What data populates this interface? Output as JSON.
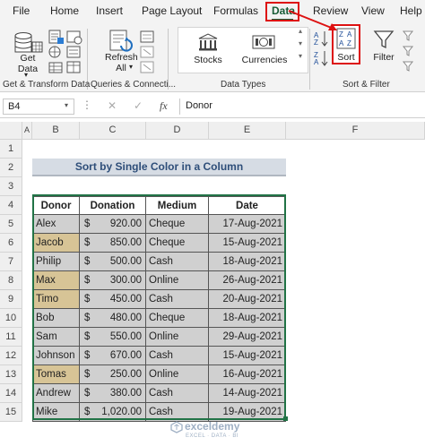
{
  "menu": {
    "items": [
      "File",
      "Home",
      "Insert",
      "Page Layout",
      "Formulas",
      "Data",
      "Review",
      "View",
      "Help"
    ]
  },
  "ribbon": {
    "get_data": "Get Data",
    "refresh_all": "Refresh All",
    "stocks": "Stocks",
    "currencies": "Currencies",
    "sort": "Sort",
    "filter": "Filter",
    "groups": {
      "get_transform": "Get & Transform Data",
      "queries": "Queries & Connecti...",
      "data_types": "Data Types",
      "sort_filter": "Sort & Filter"
    }
  },
  "formula_bar": {
    "name_box": "B4",
    "formula": "Donor"
  },
  "columns": [
    "A",
    "B",
    "C",
    "D",
    "E",
    "F"
  ],
  "rows": [
    "1",
    "2",
    "3",
    "4",
    "5",
    "6",
    "7",
    "8",
    "9",
    "10",
    "11",
    "12",
    "13",
    "14",
    "15"
  ],
  "sheet": {
    "title": "Sort by Single Color in a Column",
    "headers": [
      "Donor",
      "Donation",
      "Medium",
      "Date"
    ],
    "records": [
      {
        "donor": "Alex",
        "currency": "$",
        "amount": "920.00",
        "medium": "Cheque",
        "date": "17-Aug-2021",
        "highlight": false
      },
      {
        "donor": "Jacob",
        "currency": "$",
        "amount": "850.00",
        "medium": "Cheque",
        "date": "15-Aug-2021",
        "highlight": true
      },
      {
        "donor": "Philip",
        "currency": "$",
        "amount": "500.00",
        "medium": "Cash",
        "date": "18-Aug-2021",
        "highlight": false
      },
      {
        "donor": "Max",
        "currency": "$",
        "amount": "300.00",
        "medium": "Online",
        "date": "26-Aug-2021",
        "highlight": true
      },
      {
        "donor": "Timo",
        "currency": "$",
        "amount": "450.00",
        "medium": "Cash",
        "date": "20-Aug-2021",
        "highlight": true
      },
      {
        "donor": "Bob",
        "currency": "$",
        "amount": "480.00",
        "medium": "Cheque",
        "date": "18-Aug-2021",
        "highlight": false
      },
      {
        "donor": "Sam",
        "currency": "$",
        "amount": "550.00",
        "medium": "Online",
        "date": "29-Aug-2021",
        "highlight": false
      },
      {
        "donor": "Johnson",
        "currency": "$",
        "amount": "670.00",
        "medium": "Cash",
        "date": "15-Aug-2021",
        "highlight": false
      },
      {
        "donor": "Tomas",
        "currency": "$",
        "amount": "250.00",
        "medium": "Online",
        "date": "16-Aug-2021",
        "highlight": true
      },
      {
        "donor": "Andrew",
        "currency": "$",
        "amount": "380.00",
        "medium": "Cash",
        "date": "14-Aug-2021",
        "highlight": false
      },
      {
        "donor": "Mike",
        "currency": "$",
        "amount": "1,020.00",
        "medium": "Cash",
        "date": "19-Aug-2021",
        "highlight": false
      }
    ]
  },
  "watermark": {
    "brand": "exceldemy",
    "tagline": "EXCEL · DATA · BI"
  },
  "colors": {
    "accent": "#217346",
    "annotation_red": "#dd1111",
    "highlight_gold": "#d7c496",
    "cell_gray": "#d0d0d0",
    "title_fill": "#d6dce4"
  }
}
